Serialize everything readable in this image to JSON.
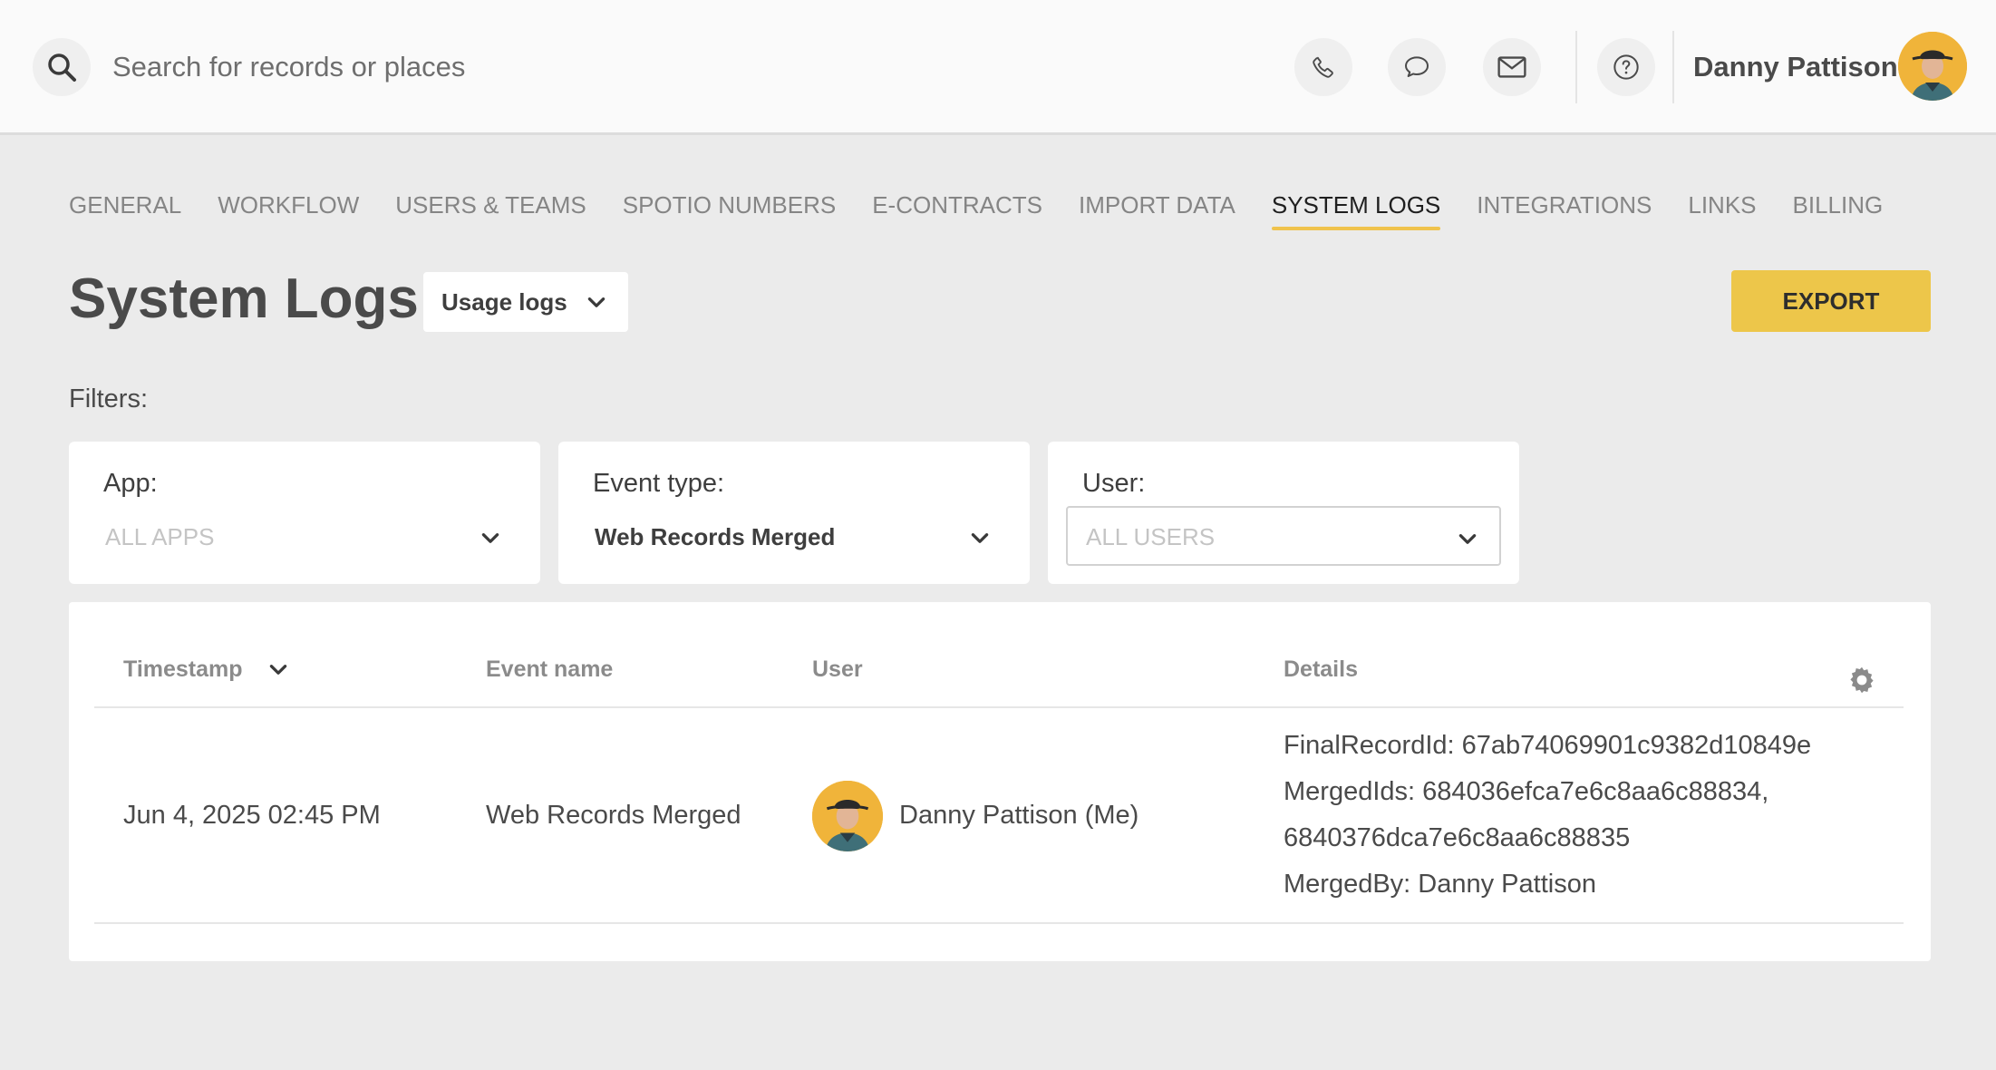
{
  "topbar": {
    "search_placeholder": "Search for records or places",
    "icons": [
      "search-icon",
      "phone-icon",
      "chat-icon",
      "mail-icon",
      "help-icon"
    ],
    "user_name": "Danny Pattison"
  },
  "nav": {
    "items": [
      "GENERAL",
      "WORKFLOW",
      "USERS & TEAMS",
      "SPOTIO NUMBERS",
      "E-CONTRACTS",
      "IMPORT DATA",
      "SYSTEM LOGS",
      "INTEGRATIONS",
      "LINKS",
      "BILLING"
    ],
    "active": "SYSTEM LOGS"
  },
  "header": {
    "title": "System Logs",
    "log_type": "Usage logs",
    "export_label": "EXPORT"
  },
  "filters": {
    "label": "Filters:",
    "app": {
      "label": "App:",
      "value": "ALL APPS"
    },
    "event_type": {
      "label": "Event type:",
      "value": "Web Records Merged"
    },
    "user": {
      "label": "User:",
      "value": "ALL USERS"
    }
  },
  "table": {
    "columns": [
      "Timestamp",
      "Event name",
      "User",
      "Details"
    ],
    "rows": [
      {
        "timestamp": "Jun 4, 2025 02:45 PM",
        "event_name": "Web Records Merged",
        "user": "Danny Pattison (Me)",
        "details": [
          "FinalRecordId: 67ab74069901c9382d10849e",
          "MergedIds: 684036efca7e6c8aa6c88834,",
          "6840376dca7e6c8aa6c88835",
          "MergedBy: Danny Pattison"
        ]
      }
    ]
  },
  "colors": {
    "accent": "#edc64a",
    "background": "#ebebeb",
    "topbar": "#fafafa",
    "avatar_bg": "#f0b43a"
  }
}
